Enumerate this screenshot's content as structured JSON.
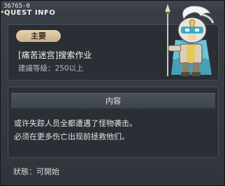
{
  "window": {
    "quest_id": "36765-0",
    "title": "QUEST INFO"
  },
  "summary": {
    "badge": "主要",
    "quest_name": "[痛苦迷宫]搜索作业",
    "level_requirement": "建議等級：250以上"
  },
  "detail": {
    "header": "内容",
    "lines": [
      "或许失踪人员全都遭遇了怪物袭击。",
      "必须在更多伤亡出现前拯救他们。"
    ]
  },
  "status": {
    "text": "狀態：可開始"
  },
  "npc": {
    "icon": "armored-knight-npc"
  },
  "colors": {
    "badge_bg": "#d9c29b",
    "panel_bg": "#2a2e35",
    "window_bg": "#363a41"
  }
}
